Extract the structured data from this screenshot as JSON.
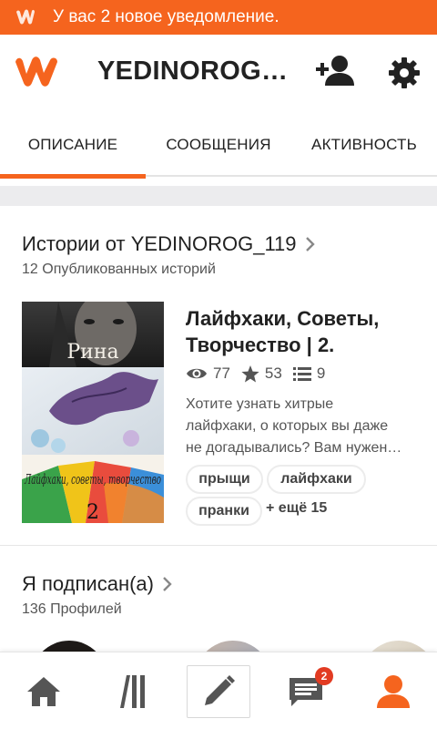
{
  "status_bar": {
    "notification": "У вас 2 новое уведомление."
  },
  "header": {
    "username": "YEDINOROG_119",
    "title_display": "YEDINOROG_..."
  },
  "tabs": [
    {
      "label": "ОПИСАНИЕ",
      "active": true
    },
    {
      "label": "СООБЩЕНИЯ",
      "active": false
    },
    {
      "label": "АКТИВНОСТЬ",
      "active": false
    }
  ],
  "stories": {
    "title": "Истории от YEDINOROG_119",
    "subtitle": "12 Опубликованных историй",
    "items": [
      {
        "cover_text_top": "Рина",
        "cover_text_bottom": "Лайфхаки, советы, творчество",
        "cover_number": "2",
        "title": "Лайфхаки, Советы, Творчество | 2.",
        "views": "77",
        "votes": "53",
        "parts": "9",
        "description": [
          "Хотите узнать хитрые",
          "лайфхаки, о которых вы даже",
          "не догадывались? Вам нужен…"
        ],
        "tags": [
          "прыщи",
          "лайфхаки",
          "пранки"
        ],
        "more_tags": "+ ещё 15"
      }
    ]
  },
  "following": {
    "title": "Я подписан(а)",
    "subtitle": "136 Профилей"
  },
  "bottom_nav": {
    "items": [
      {
        "name": "home",
        "icon": "home-icon"
      },
      {
        "name": "library",
        "icon": "library-icon"
      },
      {
        "name": "write",
        "icon": "pencil-icon"
      },
      {
        "name": "messages",
        "icon": "messages-icon",
        "badge": "2"
      },
      {
        "name": "profile",
        "icon": "profile-icon",
        "active": true
      }
    ]
  },
  "colors": {
    "accent": "#f5641e",
    "badge": "#e23b22",
    "text": "#222222",
    "muted": "#555555"
  }
}
